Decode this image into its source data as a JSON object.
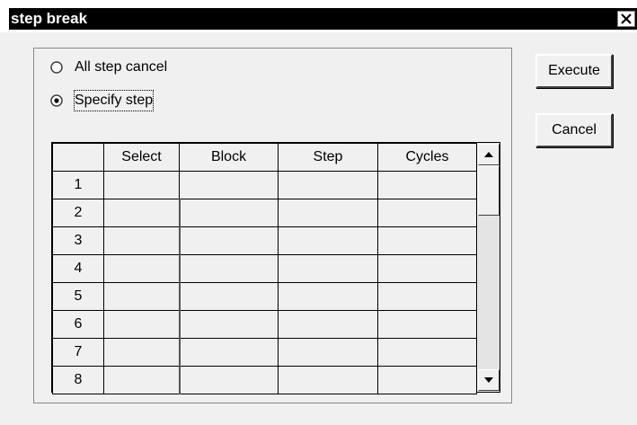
{
  "window": {
    "title": "step break"
  },
  "options": {
    "all_step_cancel": "All step cancel",
    "specify_step": "Specify step",
    "selected": "specify_step"
  },
  "buttons": {
    "execute": "Execute",
    "cancel": "Cancel"
  },
  "table": {
    "columns": [
      "",
      "Select",
      "Block",
      "Step",
      "Cycles"
    ],
    "rows": [
      {
        "num": "1",
        "select": "",
        "block": "",
        "step": "",
        "cycles": ""
      },
      {
        "num": "2",
        "select": "",
        "block": "",
        "step": "",
        "cycles": ""
      },
      {
        "num": "3",
        "select": "",
        "block": "",
        "step": "",
        "cycles": ""
      },
      {
        "num": "4",
        "select": "",
        "block": "",
        "step": "",
        "cycles": ""
      },
      {
        "num": "5",
        "select": "",
        "block": "",
        "step": "",
        "cycles": ""
      },
      {
        "num": "6",
        "select": "",
        "block": "",
        "step": "",
        "cycles": ""
      },
      {
        "num": "7",
        "select": "",
        "block": "",
        "step": "",
        "cycles": ""
      },
      {
        "num": "8",
        "select": "",
        "block": "",
        "step": "",
        "cycles": ""
      }
    ]
  },
  "icons": {
    "close": "close-icon",
    "scroll_up": "arrow-up-icon",
    "scroll_down": "arrow-down-icon"
  },
  "colors": {
    "titlebar": "#000000",
    "dialog_bg": "#f0f0f0"
  }
}
